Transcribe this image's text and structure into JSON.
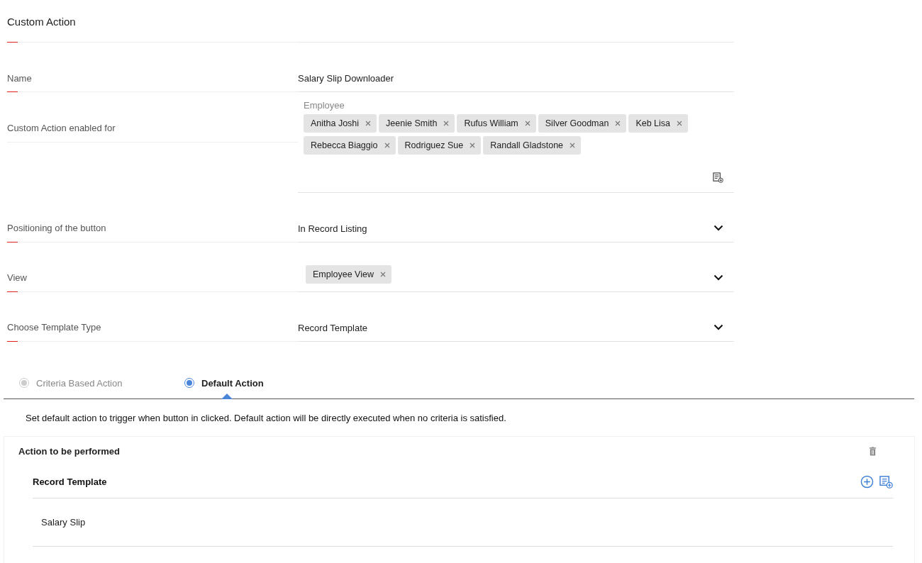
{
  "rows": [
    {
      "label": "Custom Action",
      "kind": "title",
      "marked": true
    },
    {
      "label": "Name",
      "kind": "text",
      "marked": true,
      "value": "Salary Slip Downloader"
    },
    {
      "label": "Custom Action enabled for",
      "kind": "tags",
      "marked": false,
      "caption": "Employee",
      "tags": [
        "Anitha Joshi",
        "Jeenie Smith",
        "Rufus William",
        "Silver Goodman",
        "Keb Lisa",
        "Rebecca Biaggio",
        "Rodriguez Sue",
        "Randall Gladstone"
      ]
    },
    {
      "label": "Positioning of the button",
      "kind": "select",
      "marked": true,
      "value": "In Record Listing"
    },
    {
      "label": "View",
      "kind": "select-tags",
      "marked": true,
      "tags": [
        "Employee View"
      ]
    },
    {
      "label": "Choose Template Type",
      "kind": "select",
      "marked": true,
      "value": "Record Template"
    }
  ],
  "action_tabs": [
    {
      "label": "Criteria Based Action",
      "selected": false,
      "disabled": true
    },
    {
      "label": "Default Action",
      "selected": true,
      "disabled": false
    }
  ],
  "description": "Set default action to trigger when button in clicked. Default action will be directly executed when no criteria is satisfied.",
  "action_card": {
    "title": "Action to be performed",
    "section": "Record Template",
    "items": [
      "Salary Slip"
    ]
  }
}
